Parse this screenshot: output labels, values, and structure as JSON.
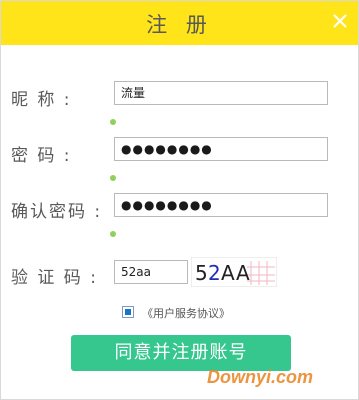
{
  "title": "注 册",
  "form": {
    "nickname": {
      "label": "昵  称 :",
      "value": "流量"
    },
    "password": {
      "label": "密  码 :",
      "value": "●●●●●●●●"
    },
    "confirm": {
      "label": "确认密码 :",
      "value": "●●●●●●●●"
    },
    "captcha": {
      "label": "验 证 码 :",
      "value": "52aa",
      "image_text": "52AA"
    }
  },
  "agreement": {
    "checked": true,
    "text": "《用户服务协议》"
  },
  "submit_label": "同意并注册账号",
  "watermark": "Downyi.com",
  "colors": {
    "title_bar": "#ffe41a",
    "button": "#35c78e",
    "validation_dot": "#8fd05a"
  },
  "icons": [
    "close-icon"
  ]
}
